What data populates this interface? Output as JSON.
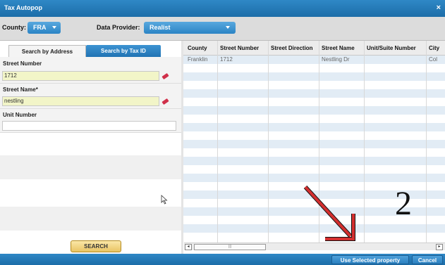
{
  "window": {
    "title": "Tax Autopop",
    "close_glyph": "×"
  },
  "toolbar": {
    "county_label": "County:",
    "county_value": "FRA",
    "provider_label": "Data Provider:",
    "provider_value": "Realist"
  },
  "left": {
    "tabs": [
      "Search by Address",
      "Search by Tax ID"
    ],
    "street_number_label": "Street Number",
    "street_number_value": "1712",
    "street_name_label": "Street Name*",
    "street_name_value": "nestling",
    "unit_number_label": "Unit Number",
    "unit_number_value": "",
    "search_button": "SEARCH"
  },
  "grid": {
    "columns": [
      "County",
      "Street Number",
      "Street Direction",
      "Street Name",
      "Unit/Suite Number",
      "City"
    ],
    "rows": [
      [
        "Franklin",
        "1712",
        "",
        "Nestling Dr",
        "",
        "Col"
      ]
    ]
  },
  "scroll": {
    "left": "◂",
    "thumb": "|||",
    "right": "▸"
  },
  "footer": {
    "use_selected": "Use Selected property",
    "cancel": "Cancel"
  },
  "annotation": {
    "number": "2",
    "arrow_color": "#c62828"
  }
}
